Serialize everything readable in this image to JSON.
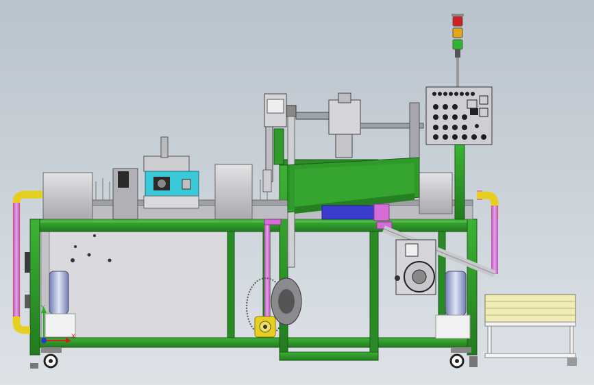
{
  "viewport": {
    "background_top": "#b9c3cc",
    "background_bottom": "#dde2e7"
  },
  "colors": {
    "frame_green": "#2f9a2a",
    "frame_dark": "#1f6b1c",
    "panel_grey": "#d3d3d6",
    "housing_grey": "#b7b7bb",
    "cyan_module": "#39c9d9",
    "blue_part": "#3c3ccf",
    "magenta_hose": "#d46ed6",
    "yellow_elbow": "#e6cf1e",
    "bin_yellow": "#f2edb6",
    "control_panel": "#c9c9cc",
    "lamp_red": "#d21e1e",
    "lamp_amber": "#e7a518",
    "lamp_green": "#2db52d"
  },
  "coordinate_triad": {
    "x_label": "X",
    "y_label": "Y",
    "icon": "coordinate-axes-icon"
  },
  "components": [
    {
      "name": "signal-tower",
      "icon": "signal-tower-icon"
    },
    {
      "name": "control-panel",
      "icon": "control-panel-icon"
    },
    {
      "name": "green-chute",
      "icon": "chute-icon"
    },
    {
      "name": "vacuum-blower",
      "icon": "blower-icon"
    },
    {
      "name": "drive-motor",
      "icon": "motor-icon"
    },
    {
      "name": "collection-bin",
      "icon": "bin-icon"
    },
    {
      "name": "caster-wheel",
      "icon": "caster-icon"
    }
  ]
}
